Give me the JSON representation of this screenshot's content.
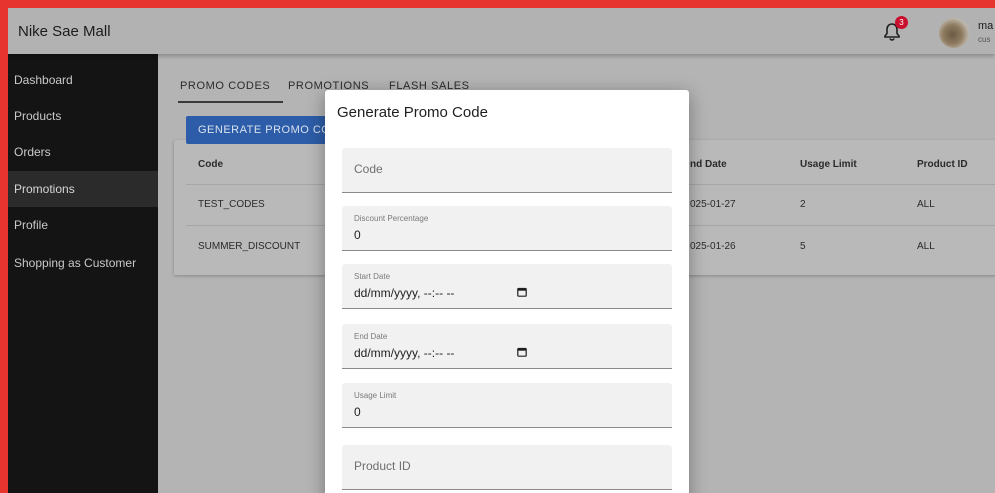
{
  "app": {
    "title": "Nike Sae Mall"
  },
  "header": {
    "notification_count": "3",
    "user_name": "ma",
    "user_role": "cus"
  },
  "sidebar": {
    "items": [
      {
        "label": "Dashboard"
      },
      {
        "label": "Products"
      },
      {
        "label": "Orders"
      },
      {
        "label": "Promotions",
        "active": true
      },
      {
        "label": "Profile"
      },
      {
        "label": "Shopping as Customer"
      }
    ]
  },
  "tabs": [
    {
      "label": "PROMO CODES",
      "active": true
    },
    {
      "label": "PROMOTIONS"
    },
    {
      "label": "FLASH SALES"
    }
  ],
  "main": {
    "generate_button_label": "GENERATE PROMO CO"
  },
  "table": {
    "columns": [
      "Code",
      "nd Date",
      "Usage Limit",
      "Product ID"
    ],
    "rows": [
      [
        "TEST_CODES",
        "025-01-27",
        "2",
        "ALL"
      ],
      [
        "SUMMER_DISCOUNT",
        "025-01-26",
        "5",
        "ALL"
      ]
    ]
  },
  "modal": {
    "title": "Generate Promo Code",
    "fields": [
      {
        "label": "Code",
        "value": ""
      },
      {
        "label": "Discount Percentage",
        "value": "0"
      },
      {
        "label": "Start Date",
        "value": "dd/mm/yyyy, --:-- --"
      },
      {
        "label": "End Date",
        "value": "dd/mm/yyyy, --:-- --"
      },
      {
        "label": "Usage Limit",
        "value": "0"
      },
      {
        "label": "Product ID",
        "value": ""
      }
    ]
  },
  "colors": {
    "frame": "#e8342e",
    "sidebar": "#141414",
    "primary_button": "#2d5da8",
    "badge": "#c8102e"
  }
}
